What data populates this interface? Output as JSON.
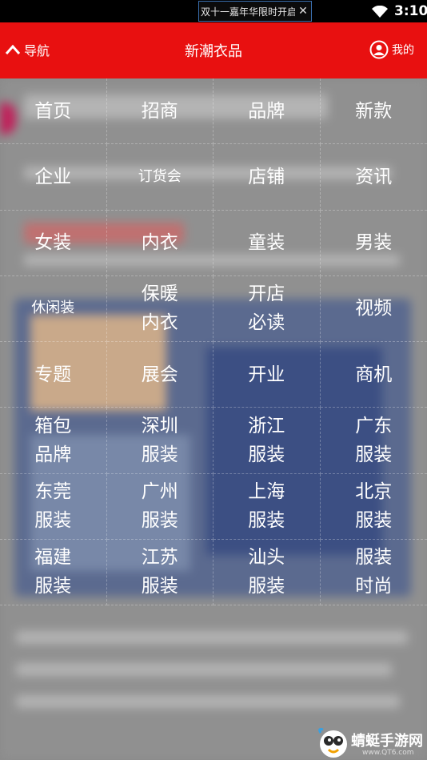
{
  "status_bar": {
    "notification": "双十一嘉年华限时开启",
    "time": "3:10"
  },
  "header": {
    "nav_label": "导航",
    "title": "新潮衣品",
    "me_label": "我的"
  },
  "menu": [
    "首页",
    "招商",
    "品牌",
    "新款",
    "企业",
    "订货会",
    "店铺",
    "资讯",
    "女装",
    "内衣",
    "童装",
    "男装",
    "休闲装",
    "保暖\n内衣",
    "开店\n必读",
    "视频",
    "专题",
    "展会",
    "开业",
    "商机",
    "箱包\n品牌",
    "深圳\n服装",
    "浙江\n服装",
    "广东\n服装",
    "东莞\n服装",
    "广州\n服装",
    "上海\n服装",
    "北京\n服装",
    "福建\n服装",
    "江苏\n服装",
    "汕头\n服装",
    "服装\n时尚"
  ],
  "watermark": {
    "text": "蜻蜓手游网",
    "url": "www.QT6.com"
  }
}
